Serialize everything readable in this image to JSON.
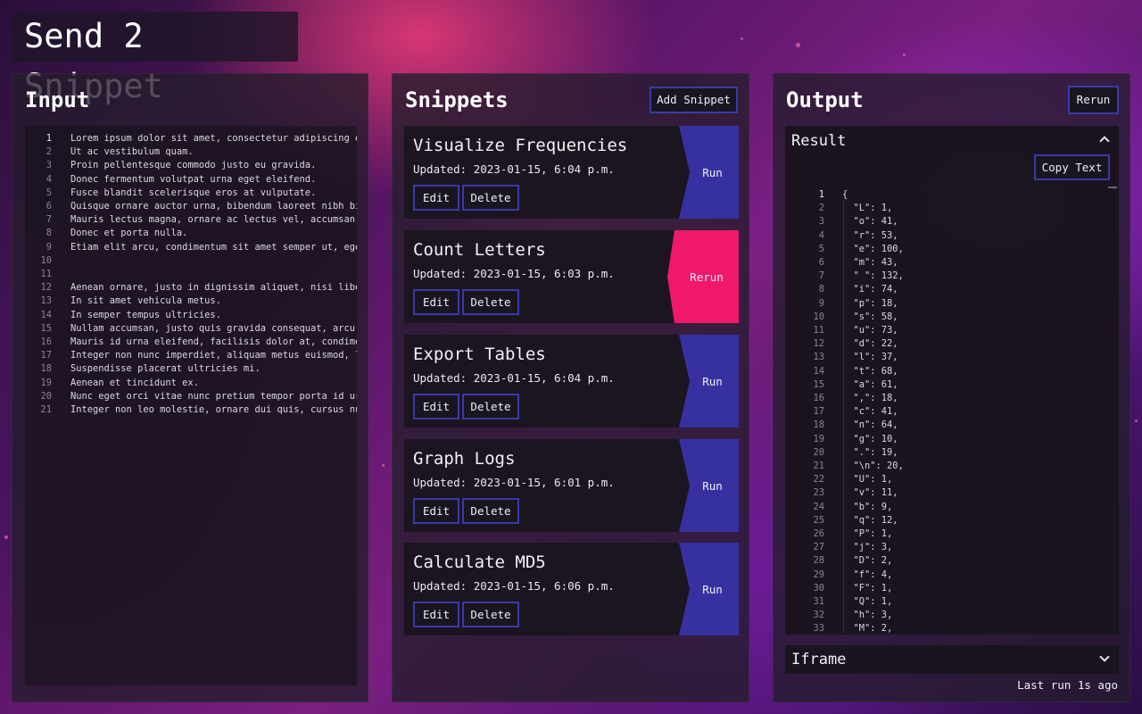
{
  "app": {
    "title": "Send 2 Snippet"
  },
  "input": {
    "title": "Input",
    "lines": [
      "Lorem ipsum dolor sit amet, consectetur adipiscing e",
      "Ut ac vestibulum quam.",
      "Proin pellentesque commodo justo eu gravida.",
      "Donec fermentum volutpat urna eget eleifend.",
      "Fusce blandit scelerisque eros at vulputate.",
      "Quisque ornare auctor urna, bibendum laoreet nibh bi",
      "Mauris lectus magna, ornare ac lectus vel, accumsan",
      "Donec et porta nulla.",
      "Etiam elit arcu, condimentum sit amet semper ut, ege",
      "",
      "",
      "Aenean ornare, justo in dignissim aliquet, nisi libe",
      "In sit amet vehicula metus.",
      "In semper tempus ultricies.",
      "Nullam accumsan, justo quis gravida consequat, arcu",
      "Mauris id urna eleifend, facilisis dolor at, condime",
      "Integer non nunc imperdiet, aliquam metus euismod, l",
      "Suspendisse placerat ultricies mi.",
      "Aenean et tincidunt ex.",
      "Nunc eget orci vitae nunc pretium tempor porta id ur",
      "Integer non leo molestie, ornare dui quis, cursus nu"
    ]
  },
  "snippets": {
    "title": "Snippets",
    "add_label": "Add Snippet",
    "edit_label": "Edit",
    "delete_label": "Delete",
    "items": [
      {
        "name": "Visualize Frequencies",
        "updated": "Updated: 2023-01-15, 6:04 p.m.",
        "action": "Run",
        "state": "idle"
      },
      {
        "name": "Count Letters",
        "updated": "Updated: 2023-01-15, 6:03 p.m.",
        "action": "Rerun",
        "state": "active"
      },
      {
        "name": "Export Tables",
        "updated": "Updated: 2023-01-15, 6:04 p.m.",
        "action": "Run",
        "state": "idle"
      },
      {
        "name": "Graph Logs",
        "updated": "Updated: 2023-01-15, 6:01 p.m.",
        "action": "Run",
        "state": "idle"
      },
      {
        "name": "Calculate MD5",
        "updated": "Updated: 2023-01-15, 6:06 p.m.",
        "action": "Run",
        "state": "idle"
      }
    ]
  },
  "output": {
    "title": "Output",
    "rerun_label": "Rerun",
    "result_label": "Result",
    "copy_label": "Copy Text",
    "iframe_label": "Iframe",
    "last_run": "Last run 1s ago",
    "json_lines": [
      "{",
      "  \"L\": 1,",
      "  \"o\": 41,",
      "  \"r\": 53,",
      "  \"e\": 100,",
      "  \"m\": 43,",
      "  \" \": 132,",
      "  \"i\": 74,",
      "  \"p\": 18,",
      "  \"s\": 58,",
      "  \"u\": 73,",
      "  \"d\": 22,",
      "  \"l\": 37,",
      "  \"t\": 68,",
      "  \"a\": 61,",
      "  \",\": 18,",
      "  \"c\": 41,",
      "  \"n\": 64,",
      "  \"g\": 10,",
      "  \".\": 19,",
      "  \"\\n\": 20,",
      "  \"U\": 1,",
      "  \"v\": 11,",
      "  \"b\": 9,",
      "  \"q\": 12,",
      "  \"P\": 1,",
      "  \"j\": 3,",
      "  \"D\": 2,",
      "  \"f\": 4,",
      "  \"F\": 1,",
      "  \"Q\": 1,",
      "  \"h\": 3,",
      "  \"M\": 2,"
    ]
  },
  "colors": {
    "accent_run": "#3730a0",
    "accent_rerun": "#f0186a",
    "button_border": "#3a3aa8"
  }
}
